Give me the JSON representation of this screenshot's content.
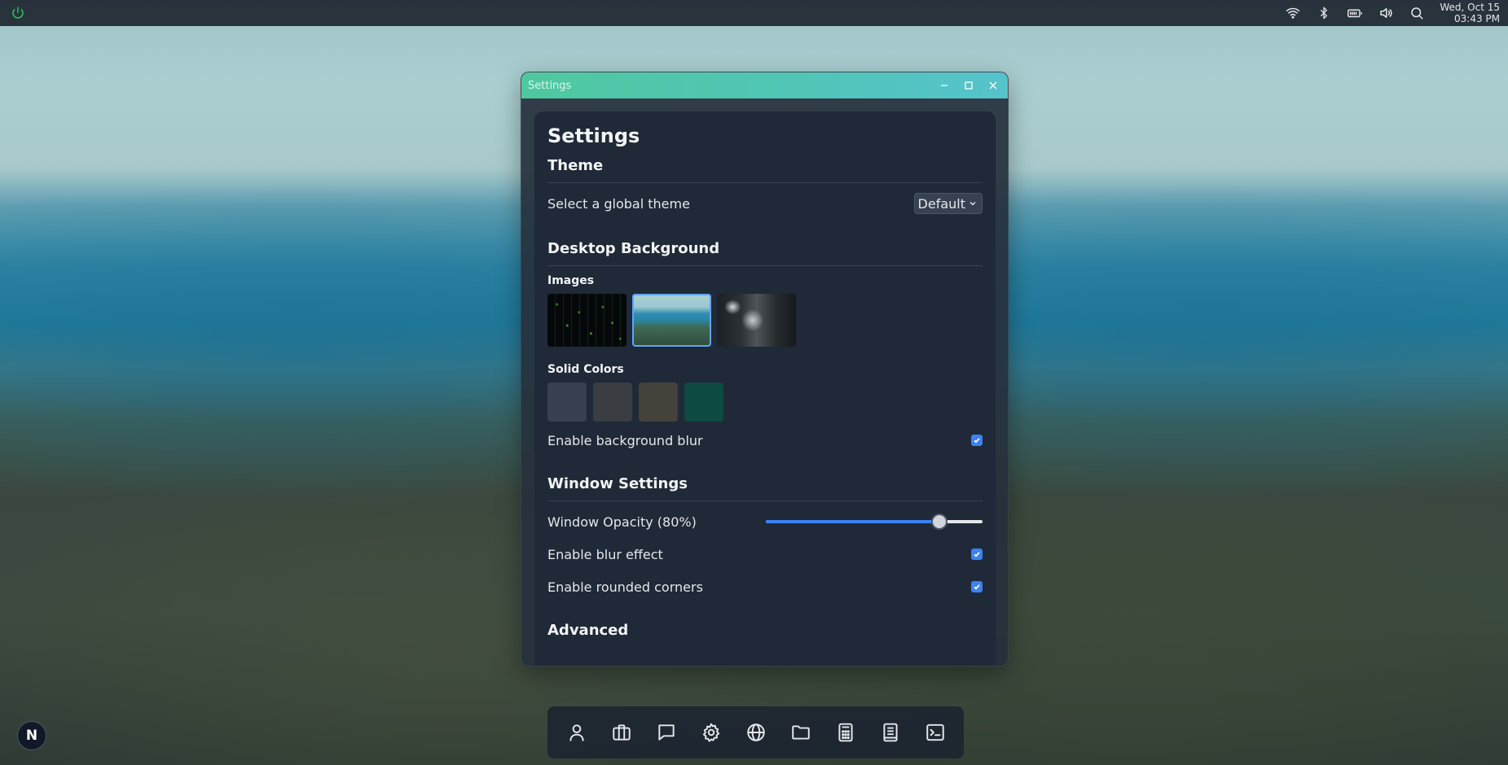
{
  "topbar": {
    "clock_date": "Wed, Oct 15",
    "clock_time": "03:43 PM",
    "icons": [
      "power-icon",
      "wifi-icon",
      "bluetooth-icon",
      "battery-icon",
      "volume-icon",
      "search-icon"
    ]
  },
  "window": {
    "title": "Settings"
  },
  "settings": {
    "heading": "Settings",
    "theme": {
      "title": "Theme",
      "label": "Select a global theme",
      "selected": "Default"
    },
    "background": {
      "title": "Desktop Background",
      "images_label": "Images",
      "images": [
        "matrix-wallpaper",
        "lake-forest-wallpaper",
        "coffee-wallpaper"
      ],
      "selected_image": 1,
      "solid_label": "Solid Colors",
      "solid_colors": [
        "#374151",
        "#3a3d42",
        "#45413b",
        "#0d4b42"
      ],
      "blur_label": "Enable background blur",
      "blur_enabled": true
    },
    "window_settings": {
      "title": "Window Settings",
      "opacity_label": "Window Opacity (80%)",
      "opacity": 0.8,
      "blur_label": "Enable blur effect",
      "blur_enabled": true,
      "rounded_label": "Enable rounded corners",
      "rounded_enabled": true
    },
    "advanced": {
      "title": "Advanced"
    }
  },
  "dock": {
    "items": [
      "user-icon",
      "briefcase-icon",
      "chat-icon",
      "settings-gear-icon",
      "globe-icon",
      "folder-icon",
      "calculator-icon",
      "notebook-icon",
      "terminal-icon"
    ]
  },
  "corner_logo": "N",
  "colors": {
    "accent": "#3b82f6",
    "titlebar_start": "#4fc8a0",
    "titlebar_end": "#55c3cc",
    "panel": "#1f2937"
  }
}
